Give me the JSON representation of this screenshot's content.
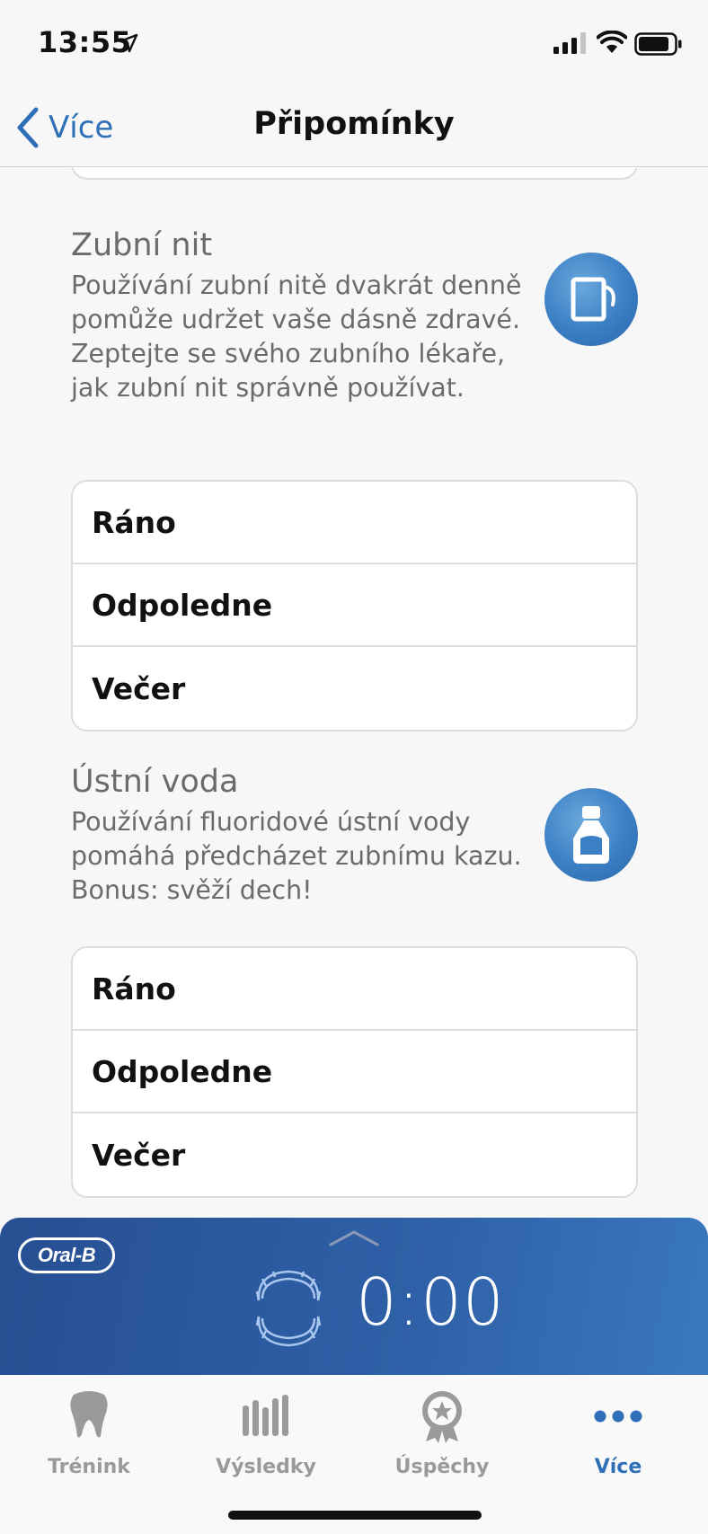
{
  "status_bar": {
    "time": "13:55",
    "icons": [
      "location-icon",
      "signal-icon",
      "wifi-icon",
      "battery-icon"
    ]
  },
  "nav": {
    "back_label": "Více",
    "title": "Připomínky"
  },
  "sections": [
    {
      "title": "Zubní nit",
      "description": "Používání zubní nitě dvakrát denně pomůže udržet vaše dásně zdravé. Zeptejte se svého zubního lékaře, jak zubní nit správně používat.",
      "icon": "floss-icon",
      "options": [
        "Ráno",
        "Odpoledne",
        "Večer"
      ]
    },
    {
      "title": "Ústní voda",
      "description": "Používání fluoridové ústní vody pomáhá předcházet zubnímu kazu. Bonus: svěží dech!",
      "icon": "mouthwash-icon",
      "options": [
        "Ráno",
        "Odpoledne",
        "Večer"
      ]
    }
  ],
  "timer_panel": {
    "logo": "Oral-B",
    "timer": "0:00"
  },
  "tab_bar": {
    "tabs": [
      {
        "label": "Trénink",
        "icon": "tooth-icon",
        "active": false
      },
      {
        "label": "Výsledky",
        "icon": "bars-icon",
        "active": false
      },
      {
        "label": "Úspěchy",
        "icon": "award-icon",
        "active": false
      },
      {
        "label": "Více",
        "icon": "more-icon",
        "active": true
      }
    ]
  },
  "colors": {
    "accent": "#2f6fb7",
    "panel": "#2f61a8",
    "background": "#f7f7f7"
  }
}
